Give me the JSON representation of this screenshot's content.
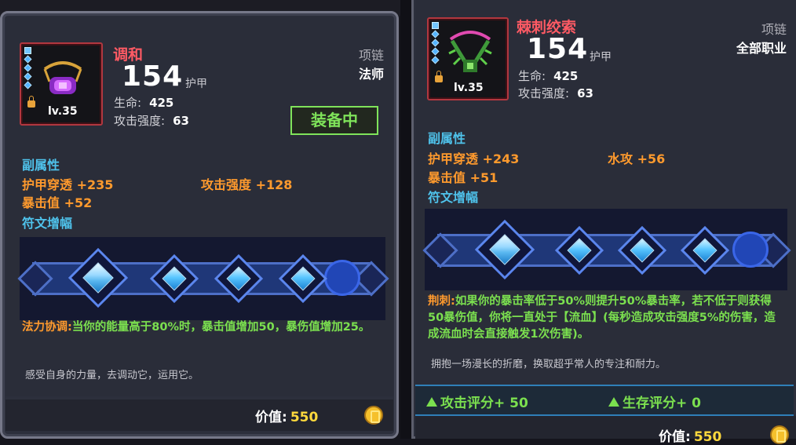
{
  "left_item": {
    "name": "调和",
    "armor_value": "154",
    "armor_unit": "护甲",
    "item_type": "项链",
    "class_req": "法师",
    "level": "lv.35",
    "stats": [
      {
        "label": "生命:",
        "value": "425"
      },
      {
        "label": "攻击强度:",
        "value": "63"
      }
    ],
    "equipped_label": "装备中",
    "secondary_title": "副属性",
    "secondary_attrs": [
      "护甲穿透 +235",
      "攻击强度 +128",
      "暴击值 +52"
    ],
    "rune_title": "符文增幅",
    "effect_name": "法力协调:",
    "effect_text": "当你的能量高于80%时，暴击值增加50，暴伤值增加25。",
    "flavor": "感受自身的力量，去调动它，运用它。",
    "price_label": "价值:",
    "price_value": "550"
  },
  "right_item": {
    "name": "棘刺绞索",
    "armor_value": "154",
    "armor_unit": "护甲",
    "item_type": "项链",
    "class_req": "全部职业",
    "level": "lv.35",
    "stats": [
      {
        "label": "生命:",
        "value": "425"
      },
      {
        "label": "攻击强度:",
        "value": "63"
      }
    ],
    "secondary_title": "副属性",
    "secondary_attrs": [
      "护甲穿透 +243",
      "水攻 +56",
      "暴击值 +51"
    ],
    "rune_title": "符文增幅",
    "effect_name": "荆刺:",
    "effect_text": "如果你的暴击率低于50%则提升50%暴击率，若不低于则获得50暴伤值，你将一直处于【流血】(每秒造成攻击强度5%的伤害，造成流血时会直接触发1次伤害)。",
    "flavor": "拥抱一场漫长的折磨，换取超乎常人的专注和耐力。",
    "score_attack": "攻击评分+ 50",
    "score_survival": "生存评分+ 0",
    "price_label": "价值:",
    "price_value": "550"
  },
  "colors": {
    "item_name": "#ff5a64",
    "section_title": "#4fc3ec",
    "attribute": "#ff9a2d",
    "effect": "#7be04f",
    "price": "#ffd93d",
    "equipped": "#7fe35a"
  },
  "icons": [
    "gem-icon",
    "lock-icon",
    "necklace-icon",
    "coin-icon",
    "up-arrow-icon",
    "rune-gem-icon"
  ]
}
